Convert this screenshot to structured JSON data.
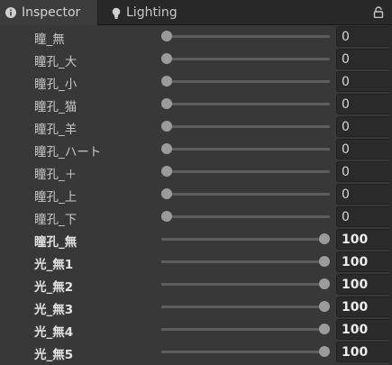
{
  "tabs": {
    "inspector": {
      "label": "Inspector",
      "icon": "info-icon"
    },
    "lighting": {
      "label": "Lighting",
      "icon": "lightbulb-icon"
    },
    "lock_icon": "lock-icon"
  },
  "sliders": [
    {
      "label": "瞳_無",
      "value": "0",
      "level": 0,
      "bold": false
    },
    {
      "label": "瞳孔_大",
      "value": "0",
      "level": 0,
      "bold": false
    },
    {
      "label": "瞳孔_小",
      "value": "0",
      "level": 0,
      "bold": false
    },
    {
      "label": "瞳孔_猫",
      "value": "0",
      "level": 0,
      "bold": false
    },
    {
      "label": "瞳孔_羊",
      "value": "0",
      "level": 0,
      "bold": false
    },
    {
      "label": "瞳孔_ハート",
      "value": "0",
      "level": 0,
      "bold": false
    },
    {
      "label": "瞳孔_＋",
      "value": "0",
      "level": 0,
      "bold": false
    },
    {
      "label": "瞳孔_上",
      "value": "0",
      "level": 0,
      "bold": false
    },
    {
      "label": "瞳孔_下",
      "value": "0",
      "level": 0,
      "bold": false
    },
    {
      "label": "瞳孔_無",
      "value": "100",
      "level": 100,
      "bold": true
    },
    {
      "label": "光_無1",
      "value": "100",
      "level": 100,
      "bold": true
    },
    {
      "label": "光_無2",
      "value": "100",
      "level": 100,
      "bold": true
    },
    {
      "label": "光_無3",
      "value": "100",
      "level": 100,
      "bold": true
    },
    {
      "label": "光_無4",
      "value": "100",
      "level": 100,
      "bold": true
    },
    {
      "label": "光_無5",
      "value": "100",
      "level": 100,
      "bold": true
    }
  ],
  "colors": {
    "track": "#5e5e5e",
    "knob": "#9b9b9b",
    "field_bg": "#2a2a2a"
  }
}
